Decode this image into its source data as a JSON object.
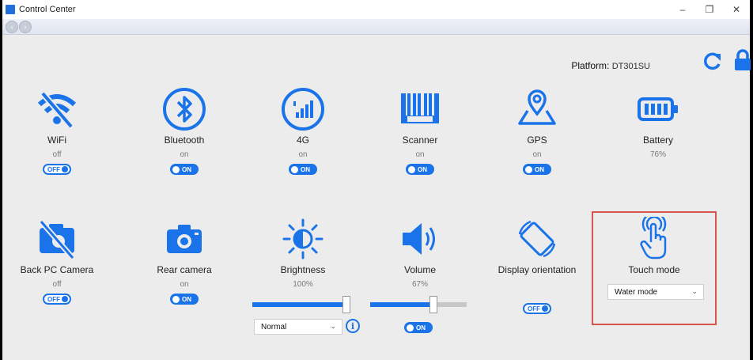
{
  "window": {
    "title": "Control Center",
    "minimize": "–",
    "restore": "❐",
    "close": "✕"
  },
  "nav": {
    "back": "‹",
    "forward": "›"
  },
  "platform": {
    "label": "Platform:",
    "value": "DT301SU"
  },
  "tiles": {
    "wifi": {
      "label": "WiFi",
      "status": "off",
      "toggle": "OFF"
    },
    "bluetooth": {
      "label": "Bluetooth",
      "status": "on",
      "toggle": "ON"
    },
    "cellular": {
      "label": "4G",
      "status": "on",
      "toggle": "ON"
    },
    "scanner": {
      "label": "Scanner",
      "status": "on",
      "toggle": "ON"
    },
    "gps": {
      "label": "GPS",
      "status": "on",
      "toggle": "ON"
    },
    "battery": {
      "label": "Battery",
      "status": "76%"
    },
    "back_camera": {
      "label": "Back PC Camera",
      "status": "off",
      "toggle": "OFF"
    },
    "rear_camera": {
      "label": "Rear camera",
      "status": "on",
      "toggle": "ON"
    },
    "brightness": {
      "label": "Brightness",
      "status": "100%",
      "level": 1.0,
      "mode": "Normal",
      "info": "i"
    },
    "volume": {
      "label": "Volume",
      "status": "67%",
      "level": 0.67,
      "toggle": "ON"
    },
    "display_orientation": {
      "label": "Display orientation",
      "toggle": "OFF"
    },
    "touch_mode": {
      "label": "Touch mode",
      "mode": "Water mode"
    }
  },
  "colors": {
    "accent": "#1a73e8",
    "highlight": "#d9534f"
  }
}
